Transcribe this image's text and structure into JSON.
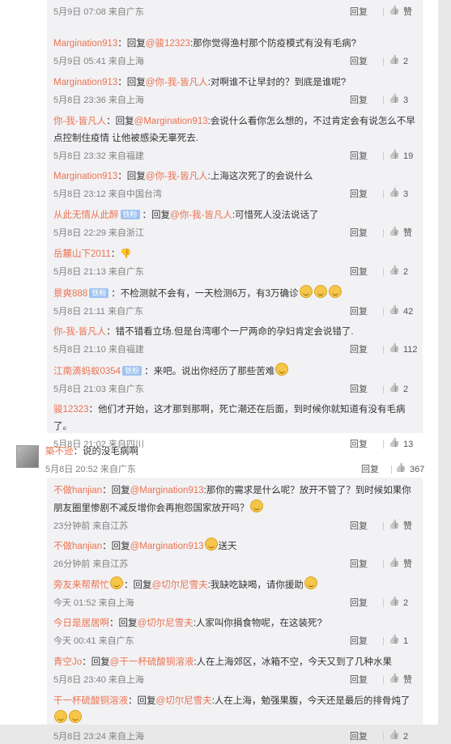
{
  "top_replies": [
    {
      "name": "",
      "reply_word": "",
      "at": "",
      "text": "",
      "time": "5月9日 07:08",
      "source": "来自广东",
      "reply_label": "回复",
      "likes": "赞",
      "partial": true
    },
    {
      "name": "Margination913",
      "reply_word": "回复",
      "at": "@骏12323",
      "text": ":那你觉得渔村那个防疫模式有没有毛病?",
      "time": "5月9日 05:41",
      "source": "来自上海",
      "reply_label": "回复",
      "likes": "2"
    },
    {
      "name": "Margination913",
      "reply_word": "回复",
      "at": "@你-我-皆凡人",
      "text": ":对啊谁不让早封的？到底是谁呢?",
      "time": "5月8日 23:36",
      "source": "来自上海",
      "reply_label": "回复",
      "likes": "3"
    },
    {
      "name": "你-我-皆凡人",
      "reply_word": "回复",
      "at": "@Margination913",
      "text": ":会说什么看你怎么想的，不过肯定会有说怎么不早点控制住疫情 让他被感染无辜死去.",
      "time": "5月8日 23:32",
      "source": "来自福建",
      "reply_label": "回复",
      "likes": "19"
    },
    {
      "name": "Margination913",
      "reply_word": "回复",
      "at": "@你-我-皆凡人",
      "text": ":上海这次死了的会说什么",
      "time": "5月8日 23:12",
      "source": "来自中国台湾",
      "reply_label": "回复",
      "likes": "3"
    },
    {
      "name": "从此无情从此醉",
      "badge": "铁粉",
      "reply_word": "回复",
      "at": "@你-我-皆凡人",
      "text": ":可惜死人没法说话了",
      "time": "5月8日 22:29",
      "source": "来自浙江",
      "reply_label": "回复",
      "likes": "赞"
    },
    {
      "name": "岳麓山下2011",
      "text": "",
      "emoji": "thumbs-down",
      "time": "5月8日 21:13",
      "source": "来自广东",
      "reply_label": "回复",
      "likes": "2"
    },
    {
      "name": "景爽888",
      "badge": "铁粉",
      "text": "不检测就不会有，一天检测6万，有3万确诊",
      "emojis": 3,
      "time": "5月8日 21:11",
      "source": "来自广东",
      "reply_label": "回复",
      "likes": "42"
    },
    {
      "name": "你-我-皆凡人",
      "text": "错不错看立场.但是台湾哪个一尸两命的孕妇肯定会说错了.",
      "time": "5月8日 21:10",
      "source": "来自福建",
      "reply_label": "回复",
      "likes": "112"
    },
    {
      "name": "江南滴蚂蚁0354",
      "badge": "铁粉",
      "text": "来吧。说出你经历了那些苦难",
      "emojis": 1,
      "time": "5月8日 21:03",
      "source": "来自广东",
      "reply_label": "回复",
      "likes": "2"
    },
    {
      "name": "骏12323",
      "text": "他们才开始，这才那到那啊，死亡潮还在后面，到时候你就知道有没有毛病了。",
      "time": "5月8日 21:02",
      "source": "来自四川",
      "reply_label": "回复",
      "likes": "13"
    }
  ],
  "main_comment": {
    "name": "築不逊",
    "text": "说的没毛病啊",
    "time": "5月8日 20:52",
    "source": "来自广东",
    "reply_label": "回复",
    "likes": "367"
  },
  "bottom_replies": [
    {
      "name": "不做hanjian",
      "reply_word": "回复",
      "at": "@Margination913",
      "text": ":那你的需求是什么呢？放开不管了？到时候如果你朋友圈里惨剧不减反增你会再抱怨国家放开吗？",
      "emojis": 1,
      "time": "23分钟前",
      "source": "来自江苏",
      "reply_label": "回复",
      "likes": "赞"
    },
    {
      "name": "不做hanjian",
      "reply_word": "回复",
      "at": "@Margination913",
      "text": "送天",
      "emojis": 1,
      "emoji_before": true,
      "time": "26分钟前",
      "source": "来自江苏",
      "reply_label": "回复",
      "likes": "赞"
    },
    {
      "name": "旁友来帮帮忙",
      "heart": true,
      "reply_word": "回复",
      "at": "@切尔尼雪夫",
      "text": ":我缺吃缺喝，请你援助",
      "emojis": 1,
      "time": "今天 01:52",
      "source": "来自上海",
      "reply_label": "回复",
      "likes": "2"
    },
    {
      "name": "今日是居居啊",
      "reply_word": "回复",
      "at": "@切尔尼雪夫",
      "text": ":人家叫你捐食物呢，在这装死?",
      "time": "今天 00:41",
      "source": "来自广东",
      "reply_label": "回复",
      "likes": "1"
    },
    {
      "name": "青空Jo",
      "reply_word": "回复",
      "at": "@干一杯硫酸铜溶液",
      "text": ":人在上海郊区，冰箱不空，今天又到了几种水果",
      "time": "5月8日 23:40",
      "source": "来自上海",
      "reply_label": "回复",
      "likes": "赞"
    },
    {
      "name": "干一杯硫酸铜溶液",
      "reply_word": "回复",
      "at": "@切尔尼雪夫",
      "text": ":人在上海，勉强果腹，今天还是最后的排骨炖了",
      "emojis": 2,
      "time": "5月8日 23:24",
      "source": "来自上海",
      "reply_label": "回复",
      "likes": "2"
    }
  ]
}
